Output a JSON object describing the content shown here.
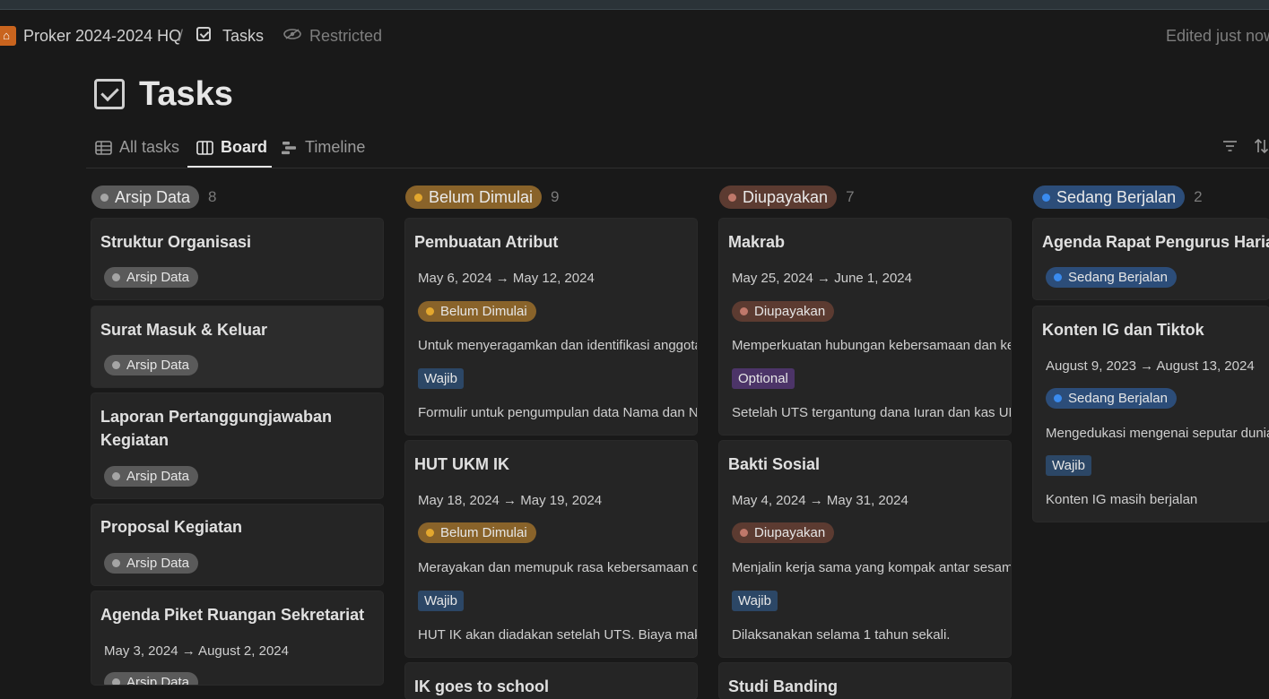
{
  "breadcrumb": {
    "workspace": "Proker 2024-2024 HQ",
    "separator": "/",
    "page": "Tasks",
    "access": "Restricted",
    "edited": "Edited just now"
  },
  "page_title": "Tasks",
  "views": [
    {
      "label": "All tasks",
      "icon": "table-icon"
    },
    {
      "label": "Board",
      "icon": "board-icon",
      "active": true
    },
    {
      "label": "Timeline",
      "icon": "timeline-icon"
    }
  ],
  "colors": {
    "arsip": "#5a5a5a",
    "arsip_dot": "#a5a5a5",
    "belum": "#89632a",
    "belum_dot": "#e3a72e",
    "diupayakan": "#5c3b31",
    "diupayakan_dot": "#c0786a",
    "sedang": "#2c4d79",
    "sedang_dot": "#3a8bef",
    "wajib": "#2c4766",
    "optional": "#4c3468"
  },
  "columns": [
    {
      "name": "Arsip Data",
      "count": "8",
      "cards": [
        {
          "title": "Struktur Organisasi",
          "status": "Arsip Data"
        },
        {
          "title": "Surat Masuk & Keluar",
          "status": "Arsip Data"
        },
        {
          "title_line1": "Laporan Pertanggungjawaban",
          "title_line2": "Kegiatan",
          "status": "Arsip Data"
        },
        {
          "title": "Proposal Kegiatan",
          "status": "Arsip Data"
        },
        {
          "title": "Agenda Piket Ruangan Sekretariat",
          "date": "May 3, 2024 → August 2, 2024",
          "status": "Arsip Data"
        }
      ]
    },
    {
      "name": "Belum Dimulai",
      "count": "9",
      "cards": [
        {
          "title": "Pembuatan Atribut",
          "date": "May 6, 2024 → May 12, 2024",
          "status": "Belum Dimulai",
          "desc": "Untuk menyeragamkan dan identifikasi anggota",
          "tag": "Wajib",
          "note": "Formulir untuk pengumpulan data Nama dan NIM"
        },
        {
          "title": "HUT UKM IK",
          "date": "May 18, 2024 → May 19, 2024",
          "status": "Belum Dimulai",
          "desc": "Merayakan dan memupuk rasa kebersamaan di",
          "tag": "Wajib",
          "note": "HUT IK akan diadakan setelah UTS. Biaya maksimal"
        },
        {
          "title": "IK goes to school"
        }
      ]
    },
    {
      "name": "Diupayakan",
      "count": "7",
      "cards": [
        {
          "title": "Makrab",
          "date": "May 25, 2024 → June 1, 2024",
          "status": "Diupayakan",
          "desc": "Memperkuatan hubungan kebersamaan dan ke",
          "tag": "Optional",
          "note": "Setelah UTS tergantung dana Iuran dan kas UKM"
        },
        {
          "title": "Bakti Sosial",
          "date": "May 4, 2024 → May 31, 2024",
          "status": "Diupayakan",
          "desc": "Menjalin kerja sama yang kompak antar sesama",
          "tag": "Wajib",
          "note": "Dilaksanakan selama 1 tahun sekali."
        },
        {
          "title": "Studi Banding"
        }
      ]
    },
    {
      "name": "Sedang Berjalan",
      "count": "2",
      "cards": [
        {
          "title": "Agenda Rapat Pengurus Harian",
          "status": "Sedang Berjalan"
        },
        {
          "title": "Konten IG dan Tiktok",
          "date": "August 9, 2023 → August 13, 2024",
          "status": "Sedang Berjalan",
          "desc": "Mengedukasi mengenai seputar dunia",
          "tag": "Wajib",
          "note": "Konten IG masih berjalan"
        }
      ]
    }
  ]
}
